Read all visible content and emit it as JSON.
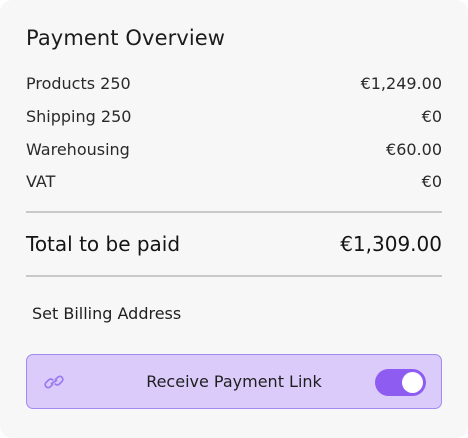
{
  "payment_overview": {
    "title": "Payment Overview",
    "line_items": [
      {
        "label": "Products 250",
        "amount": "€1,249.00"
      },
      {
        "label": "Shipping 250",
        "amount": "€0"
      },
      {
        "label": "Warehousing",
        "amount": "€60.00"
      },
      {
        "label": "VAT",
        "amount": "€0"
      }
    ],
    "total": {
      "label": "Total to be paid",
      "amount": "€1,309.00"
    },
    "billing_address_link": "Set Billing Address",
    "payment_link": {
      "icon": "link-icon",
      "label": "Receive Payment Link",
      "toggle_on": true
    }
  },
  "colors": {
    "card_background": "#f7f7f7",
    "payment_link_background": "#dacbfa",
    "payment_link_border": "#a489f0",
    "toggle_accent": "#8f5cf2",
    "link_icon": "#9b79ee"
  }
}
